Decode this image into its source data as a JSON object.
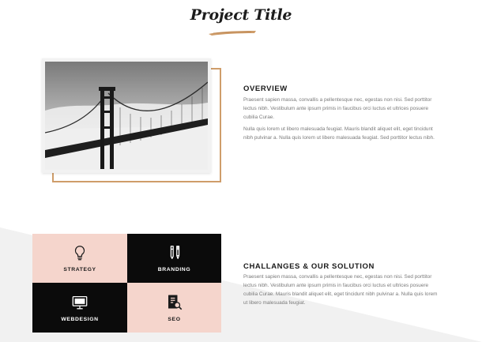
{
  "page_title": "Project Title",
  "overview": {
    "heading": "OVERVIEW",
    "paragraph_1": "Praesent sapien massa, convallis a pellentesque nec, egestas non nisi. Sed porttitor lectus nibh. Vestibulum ante ipsum primis in faucibus orci luctus et ultrices posuere cubilia Curae.",
    "paragraph_2": "Nulla quis lorem ut libero malesuada feugiat. Mauris blandit aliquet elit, eget tincidunt nibh pulvinar a. Nulla quis lorem ut libero malesuada feugiat. Sed porttitor lectus nibh."
  },
  "challenges": {
    "heading": "CHALLANGES & OUR SOLUTION",
    "paragraph": "Praesent sapien massa, convallis a pellentesque nec, egestas non nisi. Sed porttitor lectus nibh. Vestibulum ante ipsum primis in faucibus orci luctus et ultrices posuere cubilia Curae. Mauris blandit aliquet elit, eget tincidunt nibh pulvinar a. Nulla quis lorem ut libero malesuada feugiat."
  },
  "services": [
    {
      "label": "STRATEGY",
      "icon": "lightbulb-icon",
      "tone": "pink"
    },
    {
      "label": "BRANDING",
      "icon": "pen-pencil-icon",
      "tone": "dark"
    },
    {
      "label": "WEBDESIGN",
      "icon": "monitor-icon",
      "tone": "dark"
    },
    {
      "label": "SEO",
      "icon": "document-search-icon",
      "tone": "pink"
    }
  ],
  "colors": {
    "accent_gold": "#cf9d6a",
    "tile_pink": "#f5d5cc",
    "tile_dark": "#0b0b0b",
    "background_wedge": "#f1f1f1"
  }
}
